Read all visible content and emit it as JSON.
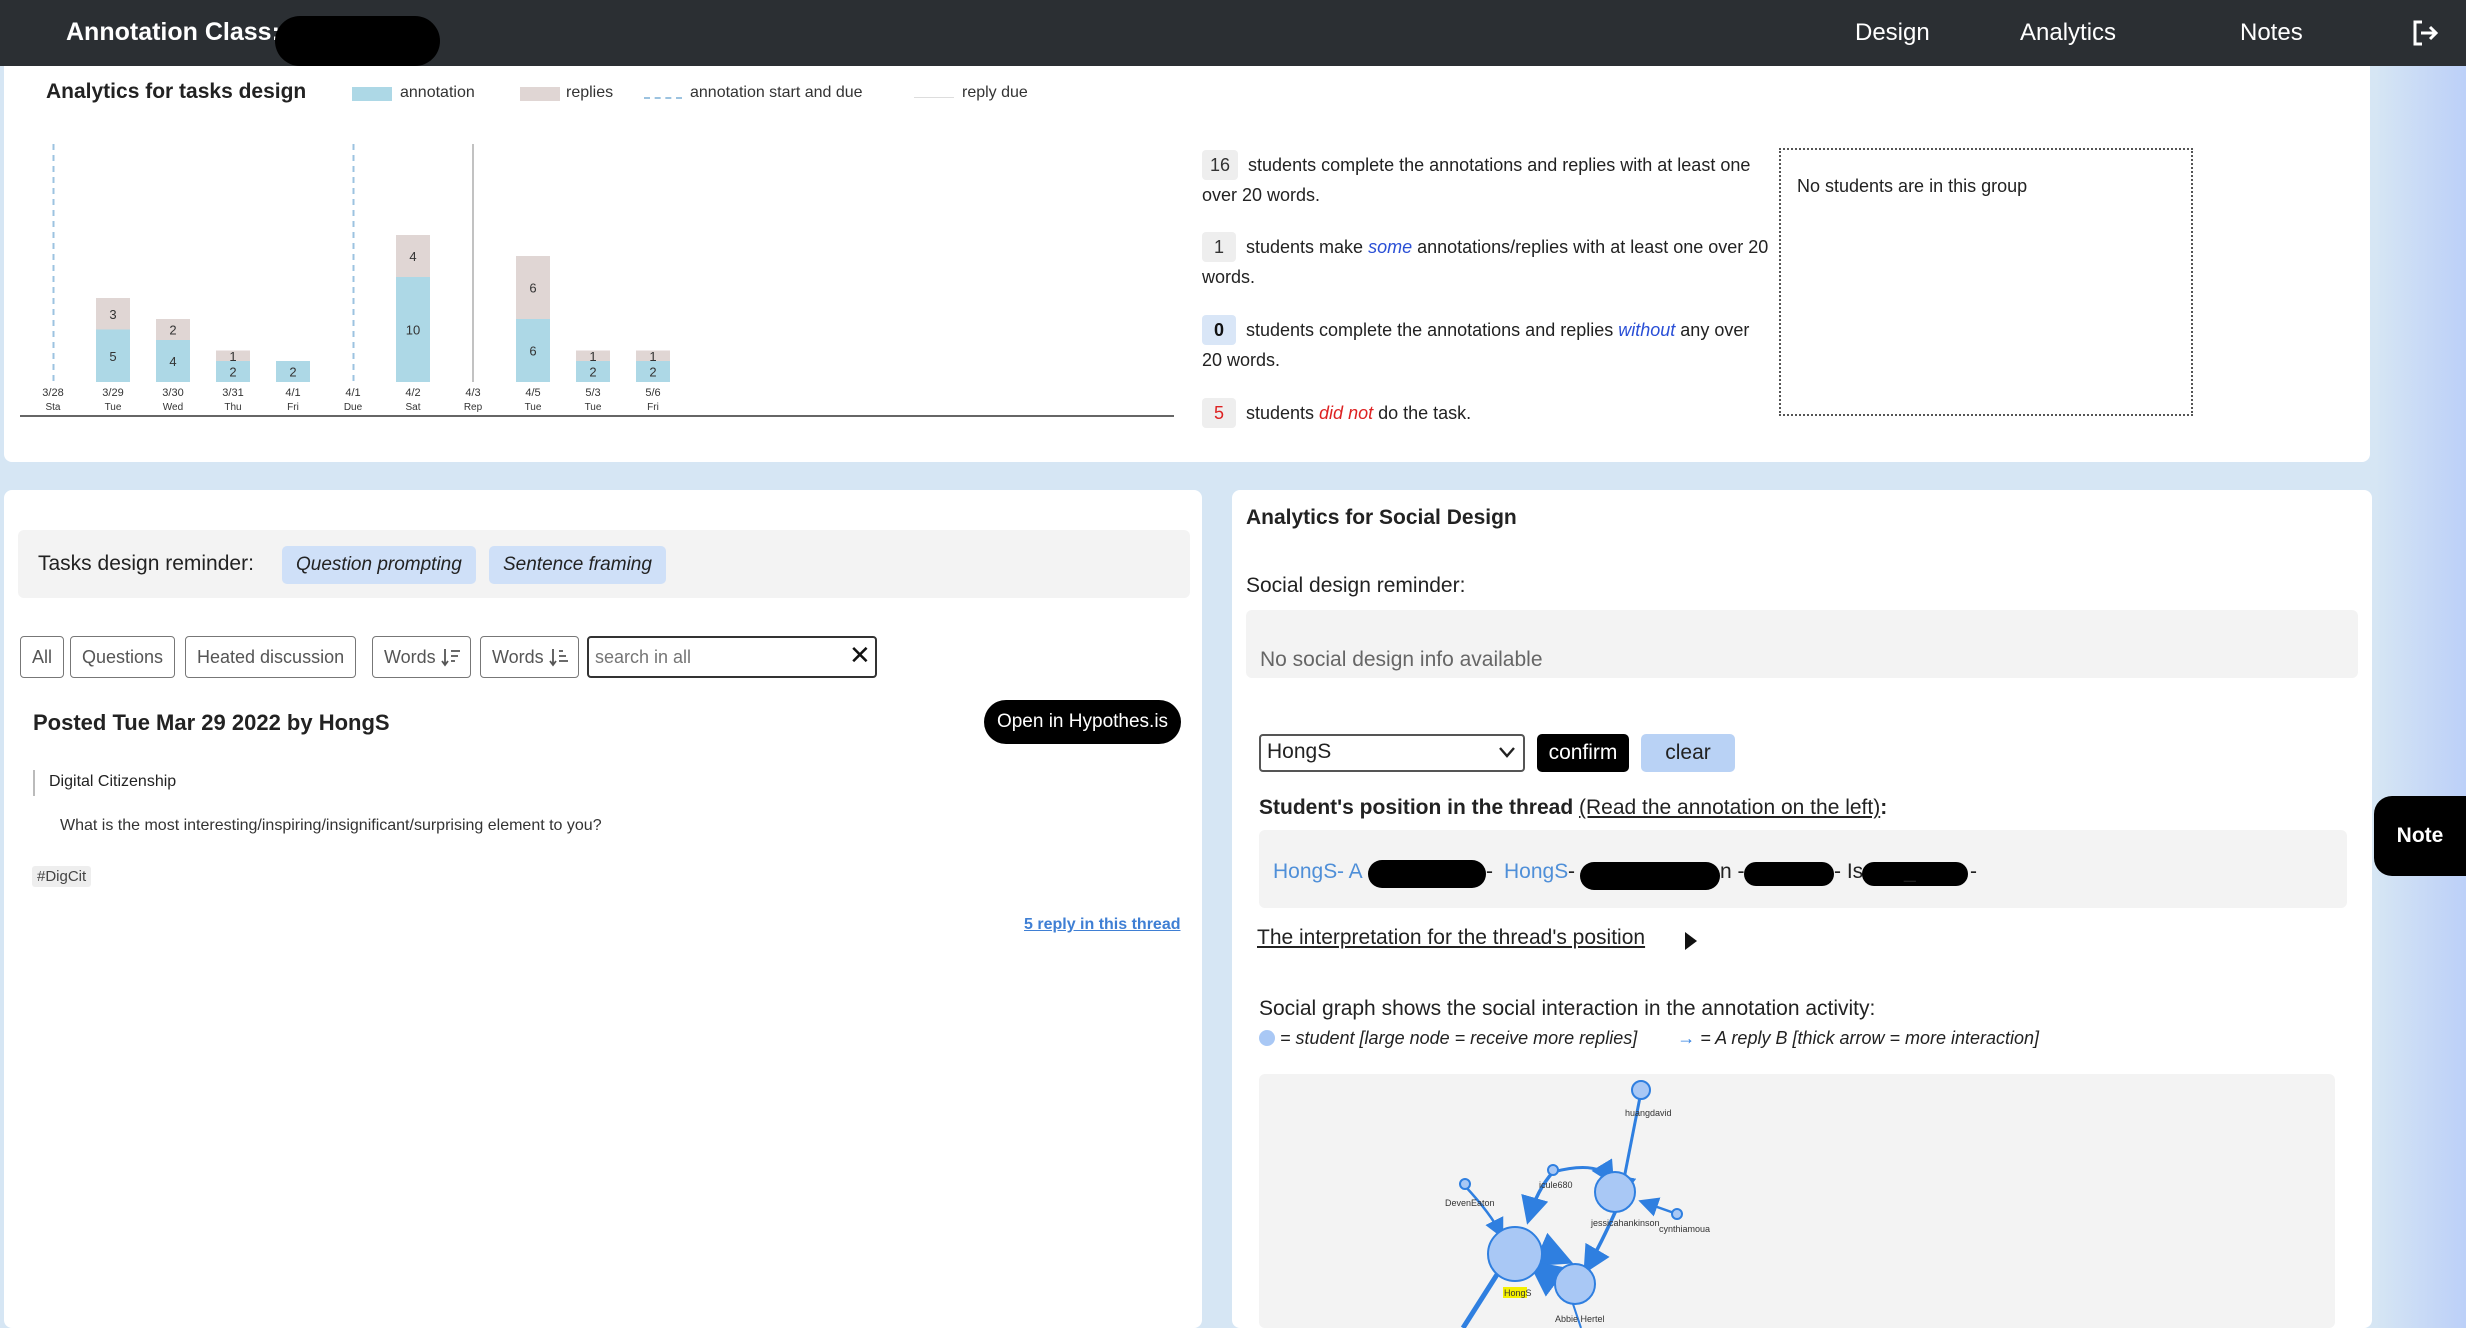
{
  "header": {
    "brand": "Annotation Class:",
    "nav": [
      "Design",
      "Analytics",
      "Notes"
    ],
    "logout_icon": "logout-icon"
  },
  "tasks_analytics": {
    "title": "Analytics for tasks design",
    "legend": {
      "annotation": "annotation",
      "replies": "replies",
      "start_due": "annotation start and due",
      "reply_due": "reply due"
    },
    "stats": [
      {
        "count": "16",
        "text_before": "students complete the annotations and replies with at least one over 20 words.",
        "emph": "",
        "text_after": ""
      },
      {
        "count": "1",
        "text_before": "students make ",
        "emph": "some",
        "text_after": " annotations/replies with at least one over 20 words."
      },
      {
        "count": "0",
        "text_before": "students complete the annotations and replies ",
        "emph": "without",
        "text_after": " any over 20 words."
      },
      {
        "count": "5",
        "text_before": "students ",
        "emph": "did not",
        "text_after": " do the task."
      }
    ],
    "group_box_text": "No students are in this group"
  },
  "chart_data": {
    "type": "bar",
    "categories": [
      "3/28",
      "3/29",
      "3/30",
      "3/31",
      "4/1",
      "4/1",
      "4/2",
      "4/3",
      "4/5",
      "5/3",
      "5/6"
    ],
    "day_labels": [
      "Sta",
      "Tue",
      "Wed",
      "Thu",
      "Fri",
      "Due",
      "Sat",
      "Rep",
      "Tue",
      "Tue",
      "Fri"
    ],
    "series": [
      {
        "name": "annotation",
        "values": [
          0,
          5,
          4,
          2,
          2,
          0,
          10,
          0,
          6,
          2,
          2
        ],
        "color": "#add8e6"
      },
      {
        "name": "replies",
        "values": [
          0,
          3,
          2,
          1,
          0,
          0,
          4,
          0,
          6,
          1,
          1
        ],
        "color": "#e0d6d4"
      }
    ],
    "start_due_markers": [
      0,
      5
    ],
    "reply_due_markers": [
      7
    ],
    "ylim": [
      0,
      16
    ],
    "grid": false,
    "legend": "top"
  },
  "tasks_reminder": {
    "label": "Tasks design reminder:",
    "tags": [
      "Question prompting",
      "Sentence framing"
    ]
  },
  "filters": {
    "buttons": [
      "All",
      "Questions",
      "Heated discussion",
      "Words",
      "Words"
    ],
    "search_placeholder": "search in all"
  },
  "post": {
    "title": "Posted Tue Mar 29 2022 by HongS",
    "open_button": "Open in Hypothes.is",
    "quote": "Digital Citizenship",
    "question": "What is the most interesting/inspiring/insignificant/surprising element to you?",
    "hashtag": "#DigCit",
    "reply_link": "5 reply in this thread"
  },
  "social": {
    "title": "Analytics for Social Design",
    "reminder_label": "Social design reminder:",
    "reminder_text": "No social design info available",
    "selected_student": "HongS",
    "confirm": "confirm",
    "clear": "clear",
    "position_title": "Student's position in the thread ",
    "position_link": "(Read the annotation on the left)",
    "position_colon": ":",
    "thread": {
      "p1": "HongS",
      "p2": " - A",
      "p3": " - ",
      "p4": "HongS",
      "p5": " - ",
      "p6": "n - r",
      "p7": " - Is",
      "p8": "_",
      "p9": " -"
    },
    "interpretation": "The interpretation for the thread's position",
    "graph_title": "Social graph shows the social interaction in the annotation activity:",
    "legend_node": " = student  [large node = receive more replies]",
    "legend_arrow": " = A reply B  [thick arrow = more interaction]",
    "nodes": [
      "huangdavid",
      "icule680",
      "DevenEaton",
      "jessicahankinson",
      "cynthiamoua",
      "HongS",
      "Abbie Hertel"
    ]
  },
  "note_tab": "Note",
  "colors": {
    "topbar": "#2b2f33",
    "annotation": "#add8e6",
    "replies": "#e0d6d4",
    "tag": "#cfe0f8",
    "link_blue": "#4f8fd8",
    "edge": "#2f7fe0",
    "node": "#a9c8f5"
  }
}
